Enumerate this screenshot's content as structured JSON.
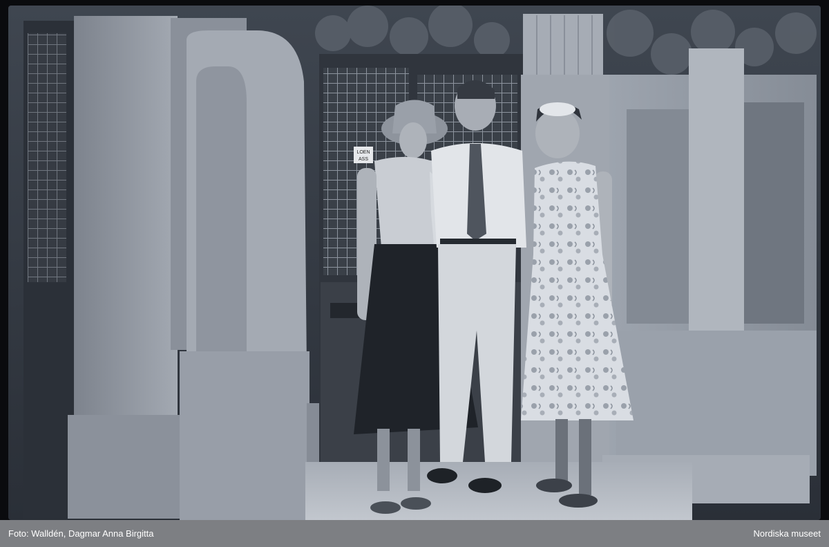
{
  "photo": {
    "sign_text": "LOEN",
    "sign_text_2": "ASS"
  },
  "caption": {
    "credit": "Foto: Walldén, Dagmar Anna Birgitta",
    "institution": "Nordiska museet"
  },
  "colors": {
    "caption_bg": "#7d7f83",
    "caption_text": "#ffffff",
    "stone": "#9aa1ab",
    "shadow": "#2c3038"
  }
}
